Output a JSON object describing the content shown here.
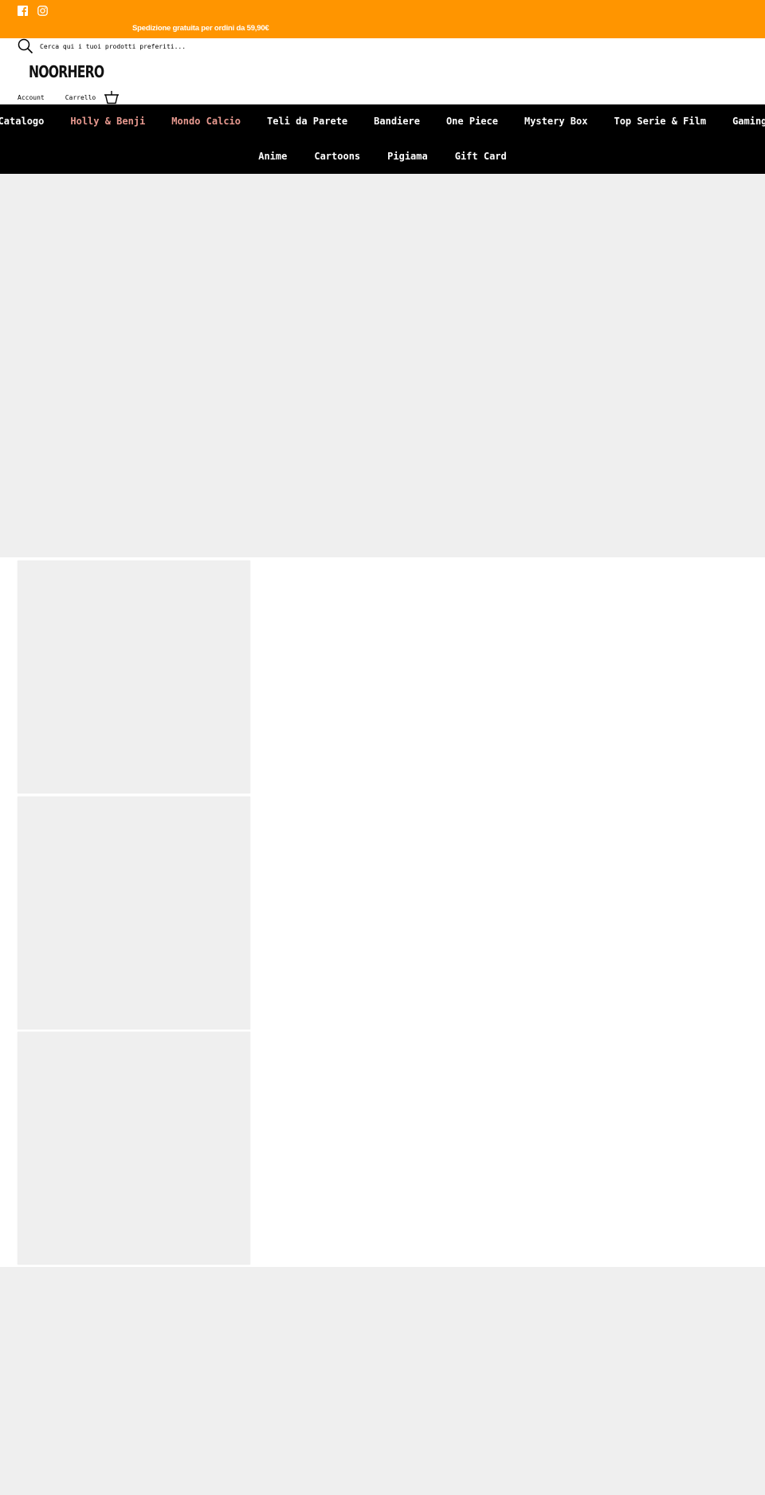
{
  "topbar": {
    "background": "#ff9500",
    "social": [
      {
        "icon": "facebook-icon",
        "label": "Facebook"
      },
      {
        "icon": "instagram-icon",
        "label": "Instagram"
      }
    ],
    "announcement": "Spedizione gratuita per ordini da 59,90€"
  },
  "header": {
    "search_placeholder": "Cerca qui i tuoi prodotti preferiti...",
    "logo": "NOORHERO",
    "account_label": "Account",
    "cart_label": "Carrello"
  },
  "nav": {
    "accent_color": "#e8998f",
    "row1": [
      {
        "label": "Catalogo",
        "accent": false
      },
      {
        "label": "Holly & Benji",
        "accent": true
      },
      {
        "label": "Mondo Calcio",
        "accent": true
      },
      {
        "label": "Teli da Parete",
        "accent": false
      },
      {
        "label": "Bandiere",
        "accent": false
      },
      {
        "label": "One Piece",
        "accent": false
      },
      {
        "label": "Mystery Box",
        "accent": false
      },
      {
        "label": "Top Serie & Film",
        "accent": false
      },
      {
        "label": "Gaming",
        "accent": false
      }
    ],
    "row2": [
      {
        "label": "Anime",
        "accent": false
      },
      {
        "label": "Cartoons",
        "accent": false
      },
      {
        "label": "Pigiama",
        "accent": false
      },
      {
        "label": "Gift Card",
        "accent": false
      }
    ]
  },
  "products": {
    "count": 3
  }
}
